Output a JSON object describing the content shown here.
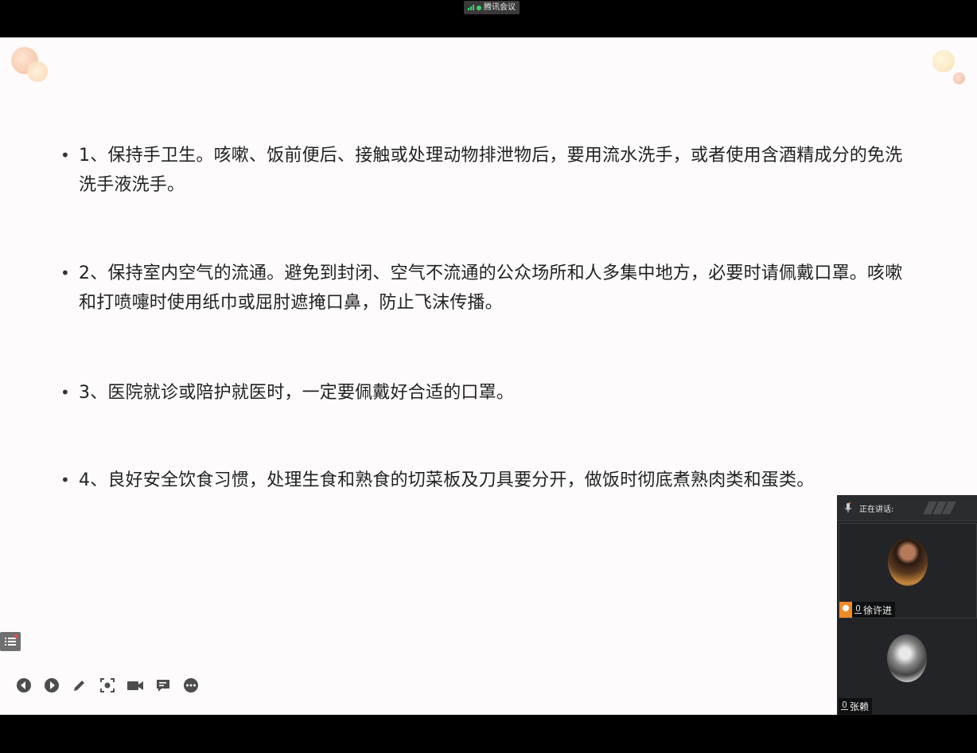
{
  "meeting": {
    "app_title": "腾讯会议"
  },
  "slide": {
    "bullets": [
      {
        "text": "1、保持手卫生。咳嗽、饭前便后、接触或处理动物排泄物后，要用流水洗手，或者使用含酒精成分的免洗洗手液洗手。"
      },
      {
        "text": "2、保持室内空气的流通。避免到封闭、空气不流通的公众场所和人多集中地方，必要时请佩戴口罩。咳嗽和打喷嚏时使用纸巾或屈肘遮掩口鼻，防止飞沫传播。"
      },
      {
        "text": "3、医院就诊或陪护就医时，一定要佩戴好合适的口罩。"
      },
      {
        "text": "4、良好安全饮食习惯，处理生食和熟食的切菜板及刀具要分开，做饭时彻底煮熟肉类和蛋类。"
      }
    ],
    "bullet_symbol": "•"
  },
  "participants": {
    "speaking_label": "正在讲话:",
    "list": [
      {
        "name": "徐许进",
        "role": "host"
      },
      {
        "name": "张赖",
        "role": "attendee"
      }
    ]
  },
  "toolbar": {
    "icons": [
      "prev-page-icon",
      "next-page-icon",
      "pen-icon",
      "screenshot-icon",
      "camera-icon",
      "comment-icon",
      "more-icon"
    ]
  },
  "colors": {
    "slide_bg": "#fdfbfc",
    "host_badge": "#f08a24",
    "status_green": "#3ad16a"
  }
}
